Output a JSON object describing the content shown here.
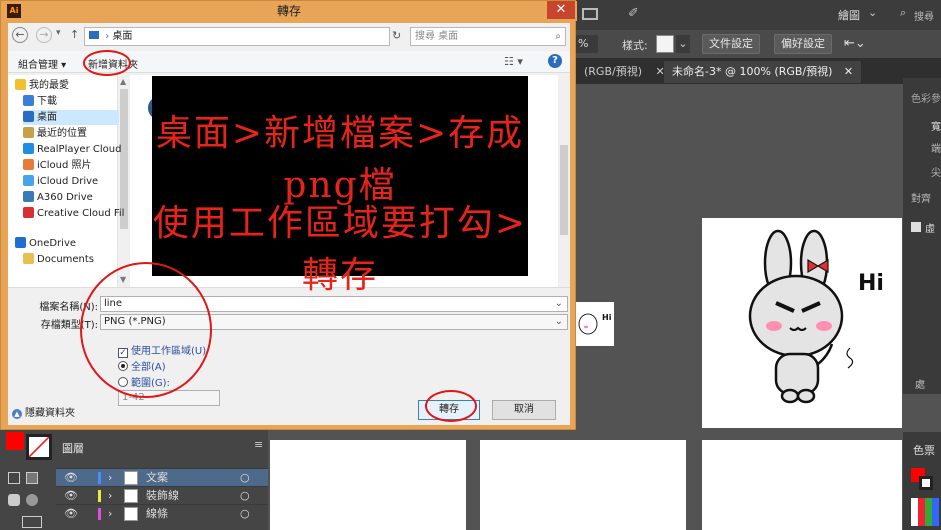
{
  "dialog": {
    "title": "轉存",
    "close_label": "✕",
    "address": {
      "path": "桌面",
      "search_placeholder": "搜尋 桌面"
    },
    "toolbar": {
      "organize_label": "組合管理 ▾",
      "new_folder_label": "新增資料夾"
    },
    "nav_items": [
      {
        "label": "我的最愛",
        "color": "#f0c030"
      },
      {
        "label": "下載",
        "color": "#3b7dd8"
      },
      {
        "label": "桌面",
        "color": "#2a6cc0"
      },
      {
        "label": "最近的位置",
        "color": "#c8a046"
      },
      {
        "label": "RealPlayer Cloud",
        "color": "#1e8fe0"
      },
      {
        "label": "iCloud 照片",
        "color": "#e87b3a"
      },
      {
        "label": "iCloud Drive",
        "color": "#4aa3e8"
      },
      {
        "label": "A360 Drive",
        "color": "#3a7ab8"
      },
      {
        "label": "Creative Cloud Fil",
        "color": "#d83030"
      },
      {
        "label": "OneDrive",
        "color": "#1f6fd0"
      },
      {
        "label": "Documents",
        "color": "#e8c050"
      }
    ],
    "overlay": {
      "line1": "桌面>新增檔案>存成png檔",
      "line2": "使用工作區域要打勾>轉存"
    },
    "form": {
      "filename_label": "檔案名稱(N):",
      "filename_value": "line",
      "filetype_label": "存檔類型(T):",
      "filetype_value": "PNG (*.PNG)",
      "use_artboards_label": "使用工作區域(U)",
      "all_label": "全部(A)",
      "range_label": "範圍(G):",
      "range_value": "1-42",
      "hide_folders_label": "隱藏資料夾",
      "save_label": "轉存",
      "cancel_label": "取消"
    }
  },
  "illustrator": {
    "menu_workspace": "繪圖",
    "search_label": "搜尋",
    "zoom_value": "%",
    "style_label": "樣式:",
    "doc_settings_label": "文件設定",
    "prefs_label": "偏好設定",
    "tabs": [
      {
        "label": "(RGB/預視)"
      },
      {
        "label": "未命名-3* @ 100% (RGB/預視)"
      }
    ],
    "hi_text": "Hi",
    "right_panel": {
      "color_label": "色彩參",
      "swatch_label": "色票",
      "warp_label": "處",
      "labels": [
        "寬",
        "端",
        "尖",
        "對齊",
        "虛"
      ]
    },
    "layers": {
      "tab_label": "圖層",
      "rows": [
        {
          "name": "文案",
          "color": "#4d8cff"
        },
        {
          "name": "裝飾線",
          "color": "#e8e84a"
        },
        {
          "name": "線條",
          "color": "#e050e0"
        }
      ]
    }
  }
}
